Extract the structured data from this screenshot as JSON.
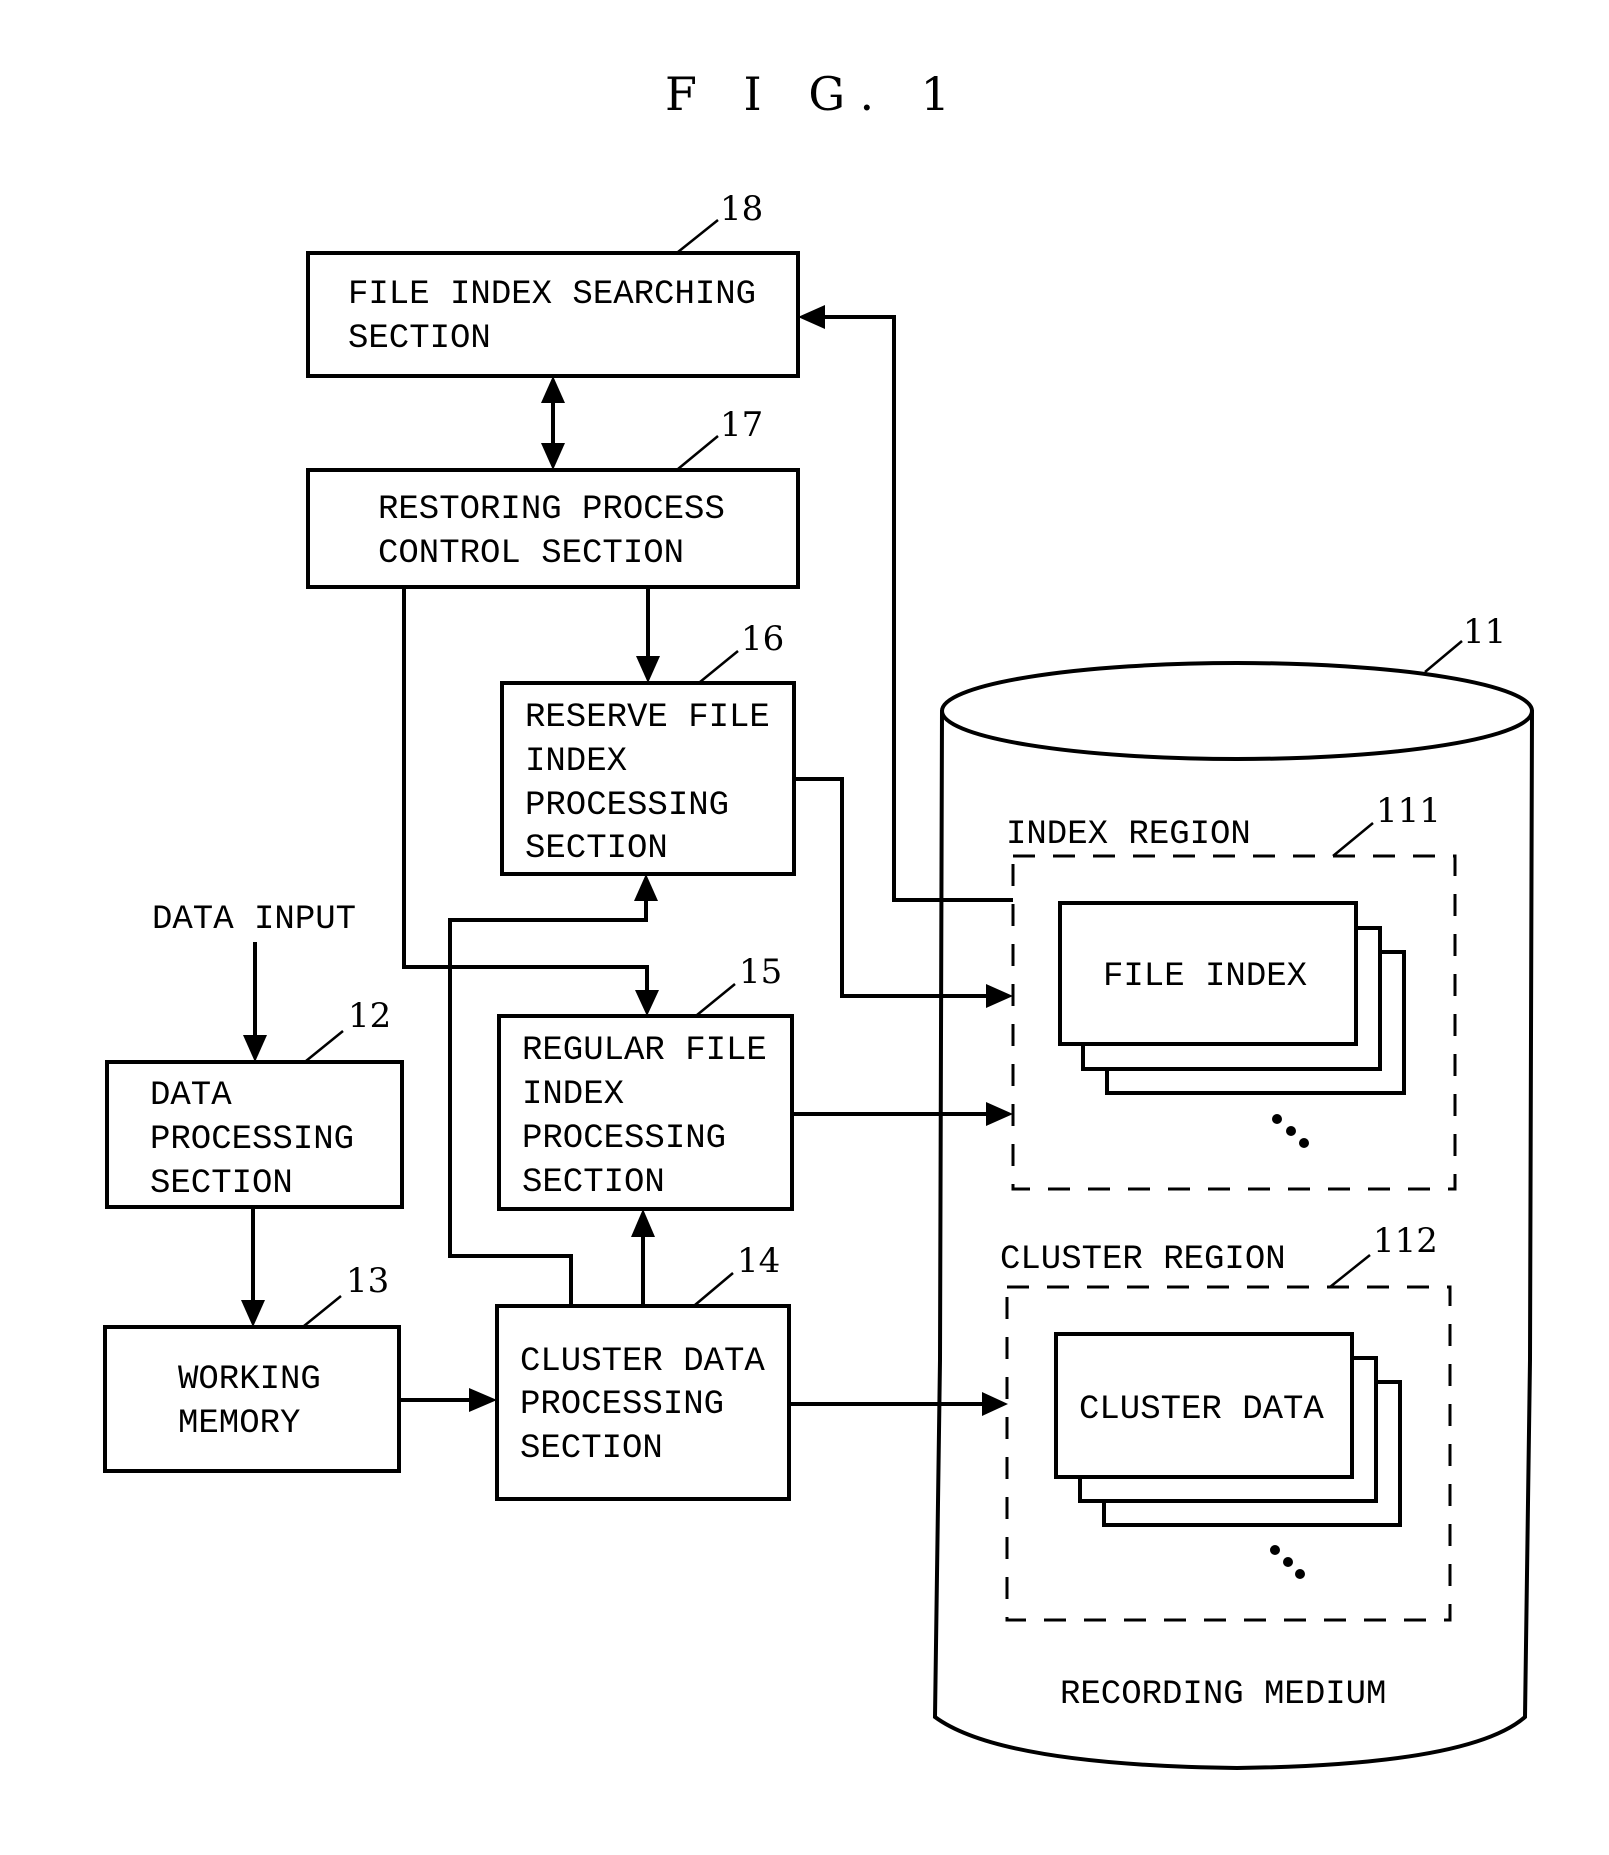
{
  "figure": {
    "title": "F I G. 1"
  },
  "blocks": {
    "file_index_searching": {
      "ref": "18",
      "lines": [
        "FILE INDEX SEARCHING",
        "SECTION"
      ]
    },
    "restoring_process_control": {
      "ref": "17",
      "lines": [
        "RESTORING PROCESS",
        "CONTROL SECTION"
      ]
    },
    "reserve_file_index_processing": {
      "ref": "16",
      "lines": [
        "RESERVE FILE",
        "INDEX",
        "PROCESSING",
        "SECTION"
      ]
    },
    "regular_file_index_processing": {
      "ref": "15",
      "lines": [
        "REGULAR FILE",
        "INDEX",
        "PROCESSING",
        "SECTION"
      ]
    },
    "cluster_data_processing": {
      "ref": "14",
      "lines": [
        "CLUSTER DATA",
        "PROCESSING",
        "SECTION"
      ]
    },
    "data_processing": {
      "ref": "12",
      "lines": [
        "DATA",
        "PROCESSING",
        "SECTION"
      ]
    },
    "working_memory": {
      "ref": "13",
      "lines": [
        "WORKING",
        "MEMORY"
      ]
    }
  },
  "data_input_label": "DATA INPUT",
  "recording_medium": {
    "ref": "11",
    "label": "RECORDING MEDIUM",
    "index_region": {
      "ref": "111",
      "label": "INDEX REGION",
      "item_label": "FILE INDEX"
    },
    "cluster_region": {
      "ref": "112",
      "label": "CLUSTER REGION",
      "item_label": "CLUSTER DATA"
    }
  },
  "connections": [
    {
      "from": "data_input",
      "to": "data_processing",
      "direction": "forward"
    },
    {
      "from": "data_processing",
      "to": "working_memory",
      "direction": "forward"
    },
    {
      "from": "working_memory",
      "to": "cluster_data_processing",
      "direction": "forward"
    },
    {
      "from": "cluster_data_processing",
      "to": "regular_file_index_processing",
      "direction": "forward"
    },
    {
      "from": "cluster_data_processing",
      "to": "reserve_file_index_processing",
      "direction": "forward"
    },
    {
      "from": "cluster_data_processing",
      "to": "cluster_region",
      "direction": "forward"
    },
    {
      "from": "regular_file_index_processing",
      "to": "index_region",
      "direction": "forward"
    },
    {
      "from": "reserve_file_index_processing",
      "to": "index_region",
      "direction": "forward"
    },
    {
      "from": "restoring_process_control",
      "to": "reserve_file_index_processing",
      "direction": "forward"
    },
    {
      "from": "restoring_process_control",
      "to": "regular_file_index_processing",
      "direction": "forward"
    },
    {
      "from": "file_index_searching",
      "to": "restoring_process_control",
      "direction": "bidirectional"
    },
    {
      "from": "index_region",
      "to": "file_index_searching",
      "direction": "forward"
    }
  ]
}
